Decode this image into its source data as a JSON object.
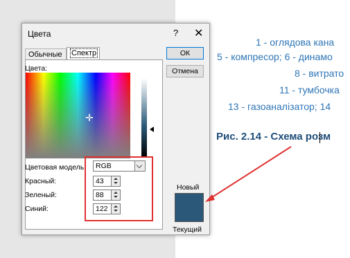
{
  "document": {
    "lines": [
      "1 - оглядова кана",
      "5 - компресор; 6 - динамо",
      "8 - витрато",
      "11 - тумбочка",
      "13 - газоаналізатор; 14"
    ],
    "figure_caption": "Рис. 2.14 - Схема розм"
  },
  "dialog": {
    "title": "Цвета",
    "help": "?",
    "close": "✕",
    "tabs": [
      "Обычные",
      "Спектр"
    ],
    "colors_label": "Цвета:",
    "color_model_label": "Цветовая модель:",
    "color_model_value": "RGB",
    "red_label": "Красный:",
    "red_value": "43",
    "green_label": "Зеленый:",
    "green_value": "88",
    "blue_label": "Синий:",
    "blue_value": "122",
    "ok_label": "ОК",
    "cancel_label": "Отмена",
    "new_label": "Новый",
    "current_label": "Текущий",
    "swatch_color": "#2b5879"
  }
}
